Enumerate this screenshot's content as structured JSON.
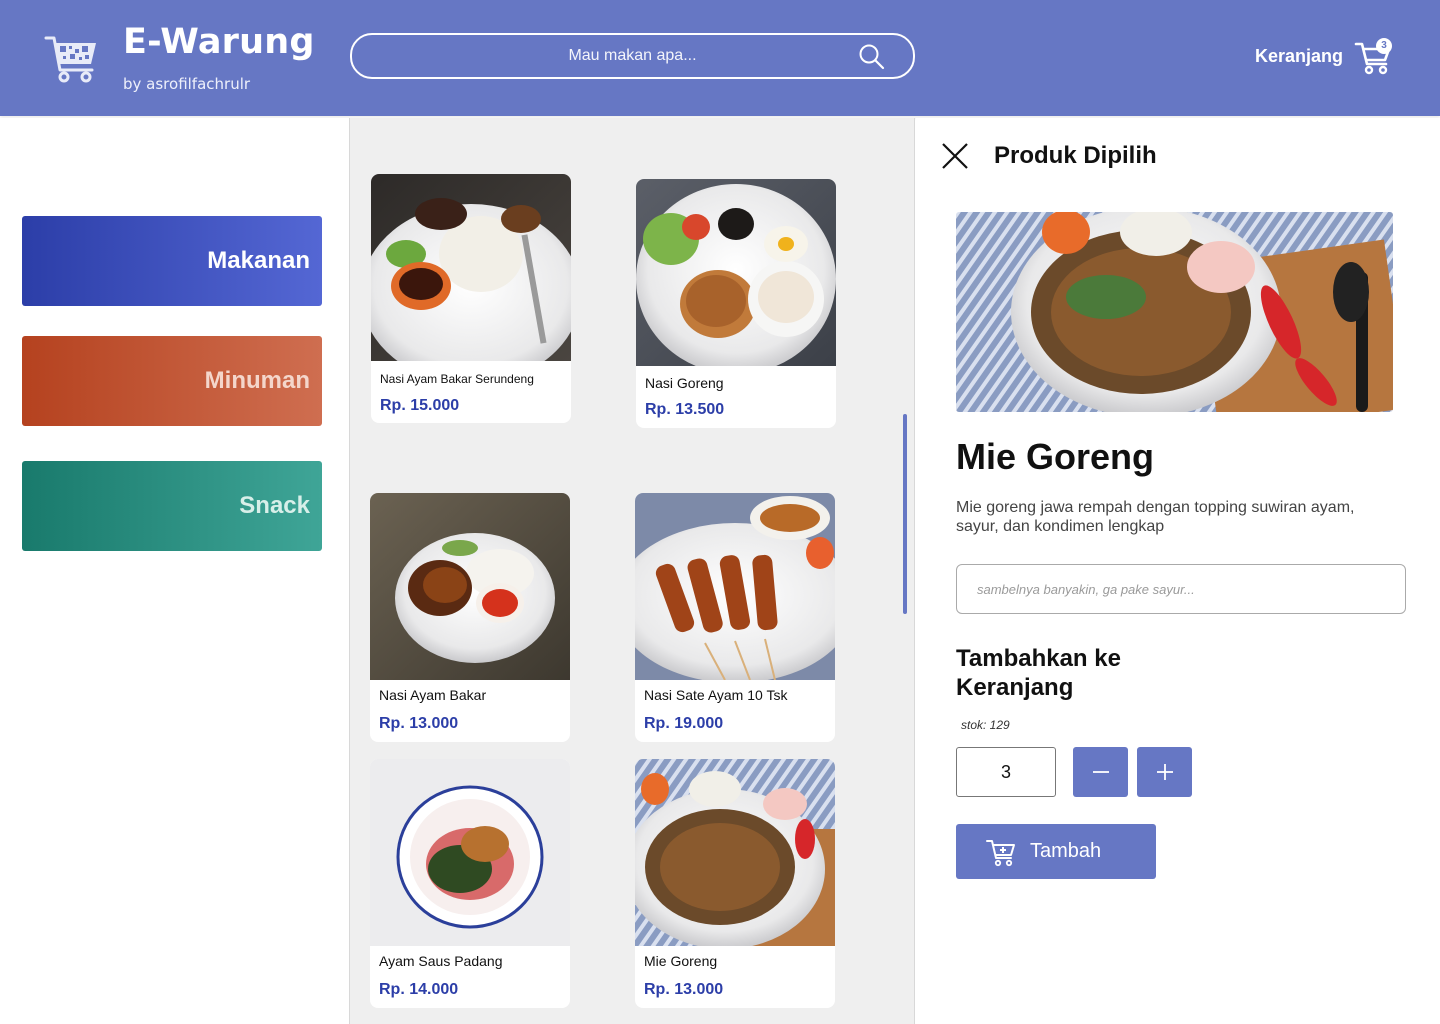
{
  "header": {
    "brand": "E-Warung",
    "brand_sub": "by asrofilfachrulr",
    "search_placeholder": "Mau makan apa...",
    "cart_label": "Keranjang",
    "cart_count": "3"
  },
  "categories": [
    {
      "label": "Makanan"
    },
    {
      "label": "Minuman"
    },
    {
      "label": "Snack"
    }
  ],
  "products": [
    {
      "name": "Nasi Ayam Bakar Serundeng",
      "price": "Rp. 15.000"
    },
    {
      "name": "Nasi Goreng",
      "price": "Rp. 13.500"
    },
    {
      "name": "Nasi Ayam Bakar",
      "price": "Rp. 13.000"
    },
    {
      "name": "Nasi Sate Ayam 10 Tsk",
      "price": "Rp. 19.000"
    },
    {
      "name": "Ayam Saus Padang",
      "price": "Rp. 14.000"
    },
    {
      "name": "Mie Goreng",
      "price": "Rp. 13.000"
    }
  ],
  "detail": {
    "title": "Produk Dipilih",
    "product_name": "Mie Goreng",
    "description": "Mie goreng jawa rempah dengan topping suwiran ayam, sayur, dan kondimen lengkap",
    "note_placeholder": "sambelnya banyakin, ga pake sayur...",
    "add_heading": "Tambahkan ke Keranjang",
    "stock": "stok: 129",
    "quantity": "3",
    "add_button": "Tambah"
  },
  "colors": {
    "primary": "#6677c4",
    "price": "#2c3ea8",
    "makanan": "#2c3ea8",
    "minuman": "#b5421f",
    "snack": "#197a6c"
  }
}
